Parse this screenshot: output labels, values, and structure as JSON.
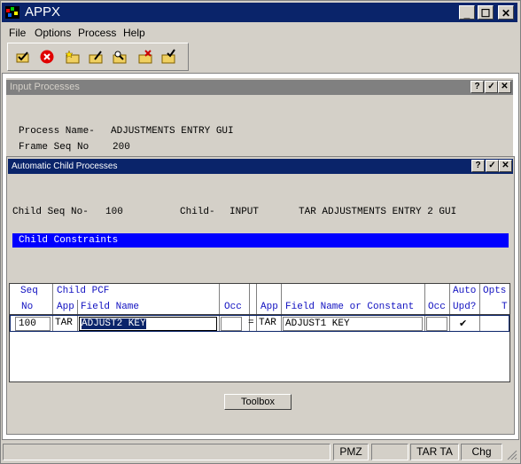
{
  "app": {
    "title": "APPX"
  },
  "menu": {
    "file": "File",
    "options": "Options",
    "process": "Process",
    "help": "Help"
  },
  "caption_buttons": {
    "minimize": "_",
    "maximize": "☐",
    "close": "✕"
  },
  "toolbar": {
    "icons": [
      "check-folder-icon",
      "cancel-icon",
      "folder-star-icon",
      "folder-pen-icon",
      "folder-search-icon",
      "folder-x-icon",
      "folder-check-icon"
    ]
  },
  "input_window": {
    "title": "Input Processes",
    "process_name_label": "Process Name-",
    "process_name": "ADJUSTMENTS ENTRY GUI",
    "frame_seq_label": "Frame Seq No",
    "frame_seq": "200"
  },
  "child_window": {
    "title": "Automatic Child Processes",
    "child_seq_label": "Child Seq No-",
    "child_seq": "100",
    "child_label": "Child-",
    "child_type": "INPUT",
    "child_name": "TAR ADJUSTMENTS ENTRY 2 GUI",
    "section_title": "Child Constraints",
    "help_btn": "?",
    "ok_btn": "✓",
    "close_btn": "✕"
  },
  "grid": {
    "headers": {
      "seq_top": "Seq",
      "seq_bottom": "No",
      "child_pcf": "Child PCF",
      "app1": "App",
      "field_name": "Field Name",
      "occ1": "Occ",
      "app2": "App",
      "field_or_const": "Field Name or Constant",
      "occ2": "Occ",
      "auto_top": "Auto",
      "auto_bottom": "Upd?",
      "opts_top": "Opts",
      "opts_bottom": "T"
    },
    "row": {
      "seq": "100",
      "app1": "TAR",
      "field": "ADJUST2 KEY",
      "occ1": "",
      "eq": "=",
      "app2": "TAR",
      "value": "ADJUST1 KEY",
      "occ2": "",
      "auto_checked": "✔",
      "opts": ""
    }
  },
  "toolbox_button": "Toolbox",
  "status": {
    "s1": "",
    "s2": "",
    "pmz": "PMZ",
    "s4": "",
    "tar": "TAR TA",
    "chg": "Chg"
  }
}
